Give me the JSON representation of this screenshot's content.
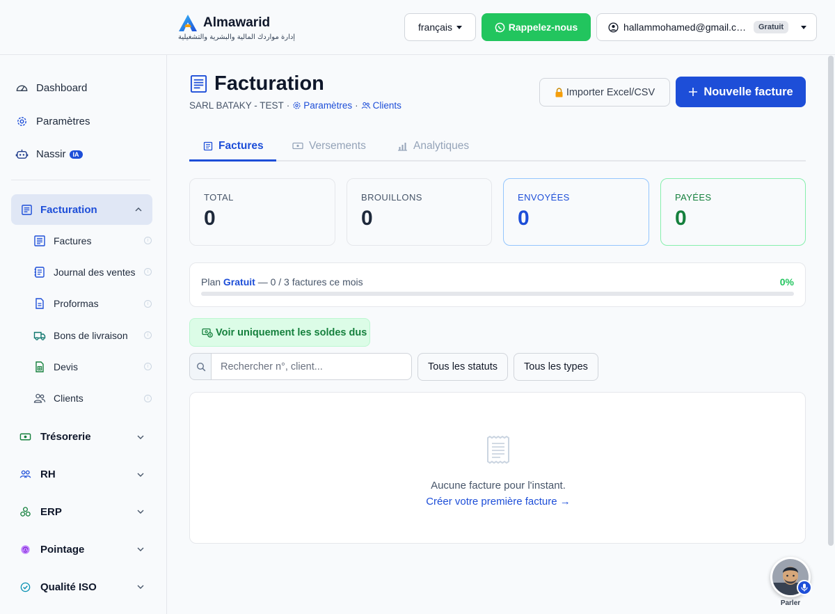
{
  "brand": {
    "name": "Almawarid",
    "subtitle": "إدارة مواردك المالية والبشرية والتشغيلية"
  },
  "header": {
    "language": "français",
    "callback_label": "Rappelez-nous",
    "user_email": "hallammohamed@gmail.com",
    "plan_badge": "Gratuit"
  },
  "sidebar": {
    "top_items": [
      {
        "label": "Dashboard",
        "icon": "gauge-icon"
      },
      {
        "label": "Paramètres",
        "icon": "gear-icon"
      },
      {
        "label": "Nassir",
        "icon": "robot-icon",
        "badge": "IA"
      }
    ],
    "active_section": {
      "label": "Facturation",
      "icon": "receipt-icon"
    },
    "sub_items": [
      {
        "label": "Factures",
        "icon": "invoice-icon"
      },
      {
        "label": "Journal des ventes",
        "icon": "journal-icon"
      },
      {
        "label": "Proformas",
        "icon": "document-icon"
      },
      {
        "label": "Bons de livraison",
        "icon": "truck-icon"
      },
      {
        "label": "Devis",
        "icon": "quote-icon"
      },
      {
        "label": "Clients",
        "icon": "users-icon"
      }
    ],
    "sections": [
      {
        "label": "Trésorerie",
        "icon": "cash-icon",
        "color": "#15803d"
      },
      {
        "label": "RH",
        "icon": "team-icon",
        "color": "#1d4ed8"
      },
      {
        "label": "ERP",
        "icon": "cubes-icon",
        "color": "#15803d"
      },
      {
        "label": "Pointage",
        "icon": "fingerprint-icon",
        "color": "#9333ea"
      },
      {
        "label": "Qualité ISO",
        "icon": "check-circle-icon",
        "color": "#0891b2"
      }
    ]
  },
  "page": {
    "title": "Facturation",
    "company": "SARL BATAKY - TEST",
    "link_settings": "Paramètres",
    "link_clients": "Clients",
    "import_label": "Importer Excel/CSV",
    "new_invoice_label": "Nouvelle facture"
  },
  "tabs": [
    {
      "label": "Factures",
      "active": true
    },
    {
      "label": "Versements",
      "active": false
    },
    {
      "label": "Analytiques",
      "active": false
    }
  ],
  "stats": [
    {
      "label": "TOTAL",
      "value": "0"
    },
    {
      "label": "BROUILLONS",
      "value": "0"
    },
    {
      "label": "ENVOYÉES",
      "value": "0"
    },
    {
      "label": "PAYÉES",
      "value": "0"
    }
  ],
  "plan": {
    "prefix": "Plan",
    "name": "Gratuit",
    "usage": "— 0 / 3 factures ce mois",
    "percent_label": "0%",
    "progress": 0
  },
  "filters": {
    "due_only_label": "Voir uniquement les soldes dus",
    "search_placeholder": "Rechercher n°, client...",
    "status_label": "Tous les statuts",
    "type_label": "Tous les types"
  },
  "empty": {
    "message": "Aucune facture pour l'instant.",
    "cta": "Créer votre première facture →"
  },
  "voice": {
    "label": "Parler"
  },
  "colors": {
    "accent": "#1d4ed8",
    "success": "#22c55e",
    "success_dark": "#15803d"
  }
}
